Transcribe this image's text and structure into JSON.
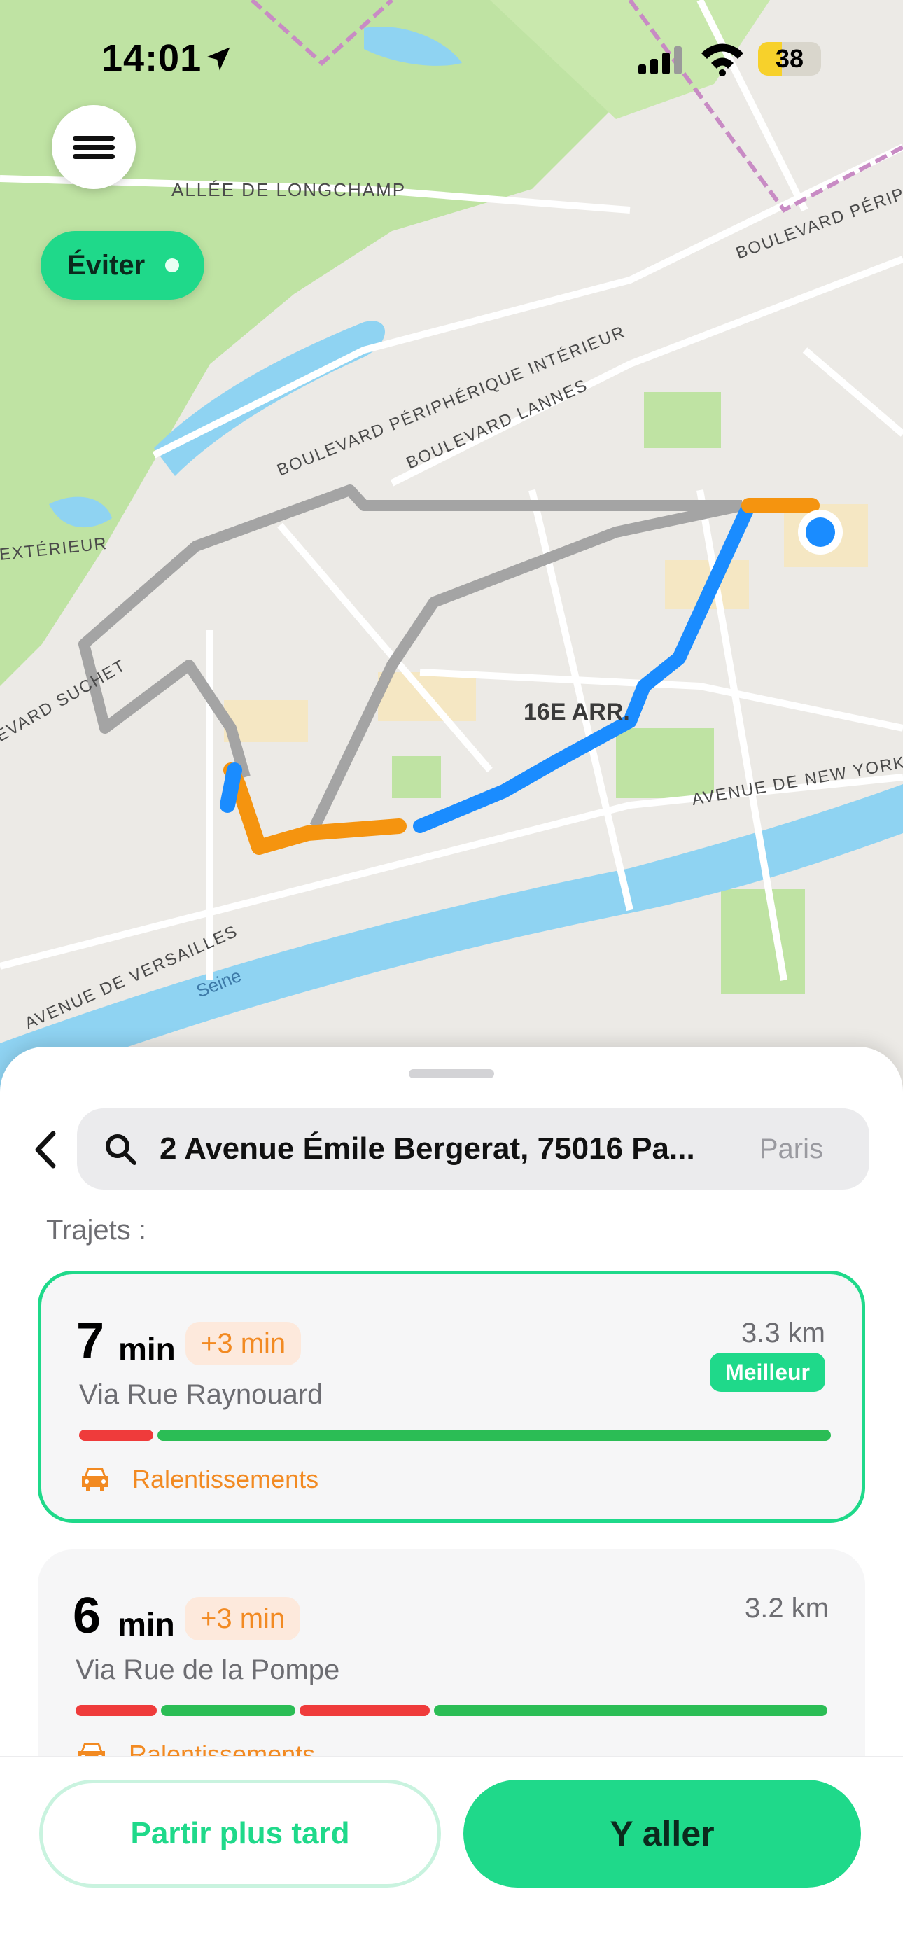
{
  "status_bar": {
    "time": "14:01",
    "battery": "38"
  },
  "map": {
    "labels": {
      "allee": "ALLÉE DE LONGCHAMP",
      "bd_periph_top": "BOULEVARD PÉRIPH",
      "bd_periph_int": "BOULEVARD PÉRIPHÉRIQUE INTÉRIEUR",
      "bd_lannes": "BOULEVARD LANNES",
      "exterieur": "EXTÉRIEUR",
      "suchet": "EVARD SUCHET",
      "arr": "16E ARR.",
      "new_york": "AVENUE DE NEW YORK",
      "versailles": "AVENUE DE VERSAILLES",
      "seine": "Seine"
    }
  },
  "controls": {
    "avoid_label": "Éviter"
  },
  "search": {
    "value": "2 Avenue Émile Bergerat, 75016 Pa...",
    "city": "Paris"
  },
  "routes_label": "Trajets :",
  "routes": [
    {
      "minutes": "7",
      "unit": "min",
      "delay": "+3 min",
      "distance": "3.3 km",
      "badge": "Meilleur",
      "via": "Via Rue Raynouard",
      "traffic": "Ralentissements",
      "selected": true
    },
    {
      "minutes": "6",
      "unit": "min",
      "delay": "+3 min",
      "distance": "3.2 km",
      "via": "Via Rue de la Pompe",
      "traffic": "Ralentissements",
      "selected": false
    }
  ],
  "actions": {
    "later": "Partir plus tard",
    "go": "Y aller"
  },
  "colors": {
    "accent": "#1fd98a",
    "route_blue": "#1a8cff",
    "route_orange": "#f5940f",
    "route_gray": "#9e9e9e",
    "traffic_red": "#ef3b3b",
    "traffic_green": "#2bbd55",
    "park": "#bfe3a3",
    "water": "#8fd3f2"
  },
  "icons": [
    "location-arrow-icon",
    "signal-icon",
    "wifi-icon",
    "battery-icon",
    "menu-icon",
    "back-chevron-icon",
    "search-icon",
    "car-icon"
  ]
}
